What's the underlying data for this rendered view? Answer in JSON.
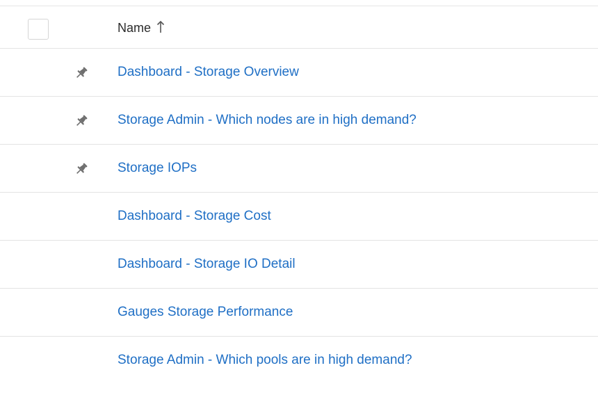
{
  "table": {
    "header": {
      "name_label": "Name",
      "sort_icon": "arrow-up-icon"
    },
    "rows": [
      {
        "name": "Dashboard - Storage Overview",
        "pinned": true,
        "pin_icon": "pin-icon"
      },
      {
        "name": "Storage Admin - Which nodes are in high demand?",
        "pinned": true,
        "pin_icon": "pin-icon"
      },
      {
        "name": "Storage IOPs",
        "pinned": true,
        "pin_icon": "pin-icon"
      },
      {
        "name": "Dashboard - Storage Cost",
        "pinned": false
      },
      {
        "name": "Dashboard - Storage IO Detail",
        "pinned": false
      },
      {
        "name": "Gauges Storage Performance",
        "pinned": false
      },
      {
        "name": "Storage Admin - Which pools are in high demand?",
        "pinned": false
      }
    ],
    "colors": {
      "link": "#1f6fc5",
      "pin": "#6f6f6f",
      "divider": "#e3e3e3"
    }
  }
}
